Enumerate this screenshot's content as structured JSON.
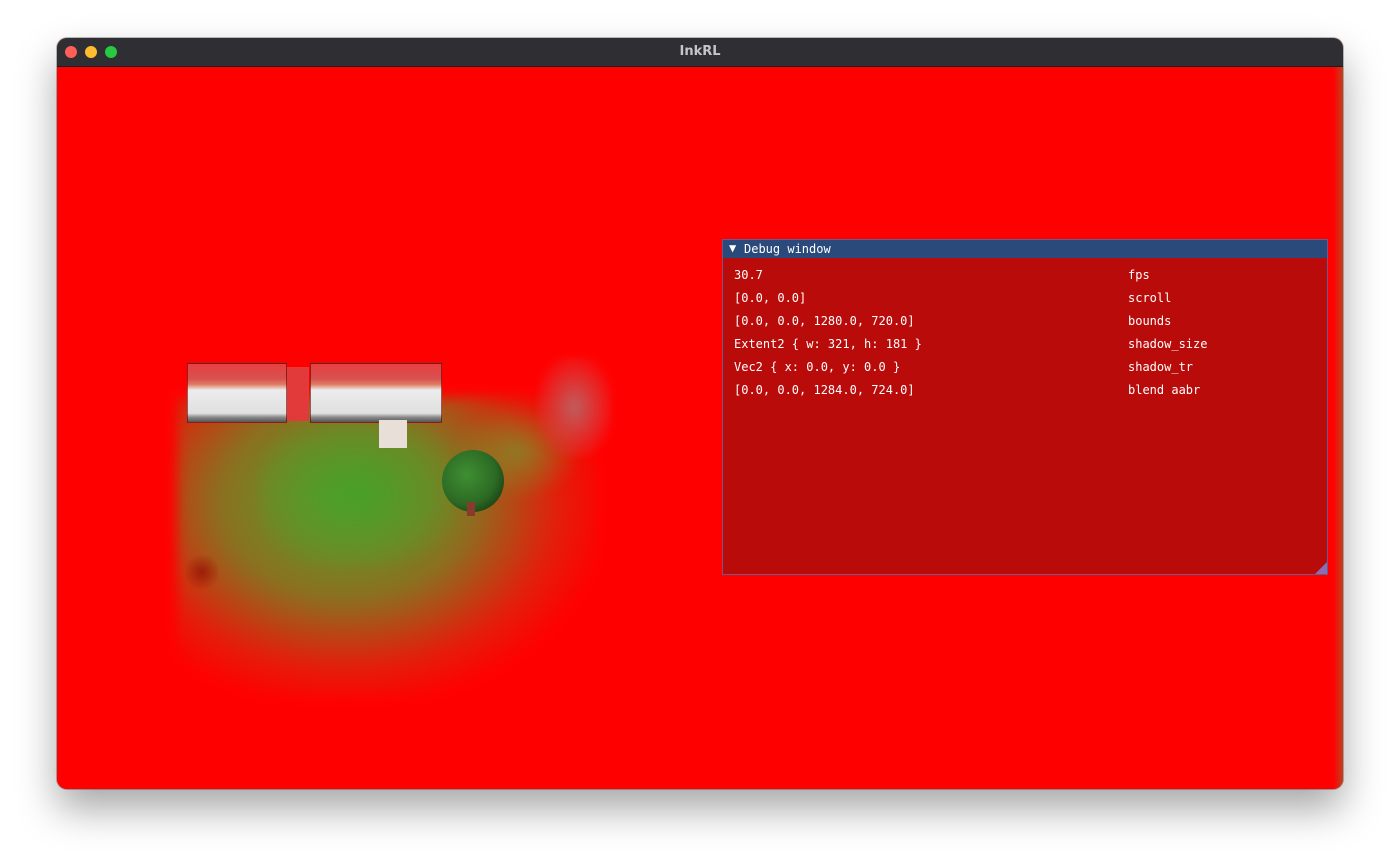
{
  "window": {
    "title": "InkRL"
  },
  "colors": {
    "background_fill": "#ff0000",
    "debug_header": "#294a7a",
    "debug_body": "#b40c0c"
  },
  "debug_window": {
    "collapse_icon": "▼",
    "title": "Debug window",
    "rows": [
      {
        "value": "30.7",
        "label": "fps"
      },
      {
        "value": "[0.0, 0.0]",
        "label": "scroll"
      },
      {
        "value": "[0.0, 0.0, 1280.0, 720.0]",
        "label": "bounds"
      },
      {
        "value": "Extent2 { w: 321, h: 181 }",
        "label": "shadow_size"
      },
      {
        "value": "Vec2 { x: 0.0, y: 0.0 }",
        "label": "shadow_tr"
      },
      {
        "value": "[0.0, 0.0, 1284.0, 724.0]",
        "label": "blend aabr"
      }
    ]
  }
}
